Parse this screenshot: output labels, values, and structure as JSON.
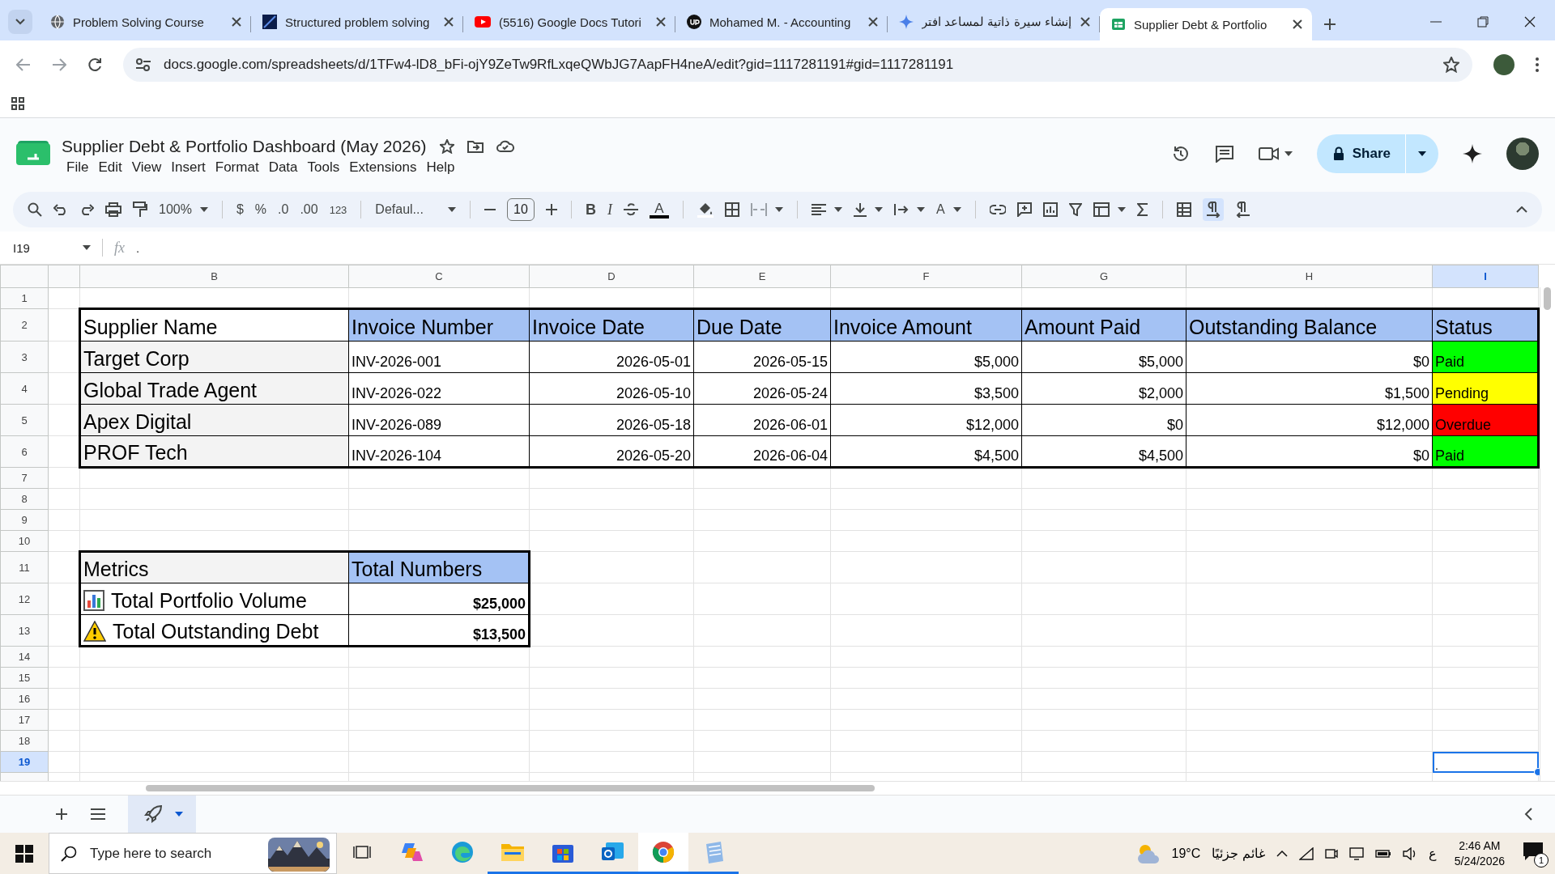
{
  "browser": {
    "tabs": [
      {
        "kind": "globe",
        "title": "Problem Solving Course",
        "selected": false
      },
      {
        "kind": "square",
        "title": "Structured problem solving",
        "selected": false
      },
      {
        "kind": "video",
        "title": "(5516) Google Docs Tutori",
        "selected": false
      },
      {
        "kind": "circle",
        "title": "Mohamed M. - Accounting",
        "selected": false
      },
      {
        "kind": "sparkle",
        "title": "إنشاء سيرة ذاتية لمساعد افتر",
        "selected": false
      },
      {
        "kind": "sheet",
        "title": "Supplier Debt & Portfolio",
        "selected": true
      }
    ],
    "url": "docs.google.com/spreadsheets/d/1TFw4-lD8_bFi-ojY9ZeTw9RfLxqeQWbJG7AapFH4neA/edit?gid=1117281191#gid=1117281191"
  },
  "document": {
    "title": "Supplier Debt & Portfolio Dashboard (May 2026)",
    "menu": [
      "File",
      "Edit",
      "View",
      "Insert",
      "Format",
      "Data",
      "Tools",
      "Extensions",
      "Help"
    ]
  },
  "share_button": {
    "label": "Share"
  },
  "toolbar": {
    "zoom": "100%",
    "currency": "$",
    "percent": "%",
    "decrease_decimals": ".0",
    "increase_decimals": ".00",
    "more_formats": "123",
    "font": "Defaul...",
    "font_size": "10",
    "bold": "B",
    "italic": "I",
    "text_color": "A",
    "text_rotation": "A"
  },
  "formula_bar": {
    "cell_ref": "I19",
    "fx": "fx",
    "content": "."
  },
  "sheet": {
    "columns": [
      {
        "label": "B",
        "selected": false
      },
      {
        "label": "C",
        "selected": false
      },
      {
        "label": "D",
        "selected": false
      },
      {
        "label": "E",
        "selected": false
      },
      {
        "label": "F",
        "selected": false
      },
      {
        "label": "G",
        "selected": false
      },
      {
        "label": "H",
        "selected": false
      },
      {
        "label": "I",
        "selected": true
      }
    ],
    "rows": [
      {
        "label": "1",
        "selected": false
      },
      {
        "label": "2",
        "selected": false
      },
      {
        "label": "3",
        "selected": false
      },
      {
        "label": "4",
        "selected": false
      },
      {
        "label": "5",
        "selected": false
      },
      {
        "label": "6",
        "selected": false
      },
      {
        "label": "7",
        "selected": false
      },
      {
        "label": "8",
        "selected": false
      },
      {
        "label": "9",
        "selected": false
      },
      {
        "label": "10",
        "selected": false
      },
      {
        "label": "11",
        "selected": false
      },
      {
        "label": "12",
        "selected": false
      },
      {
        "label": "13",
        "selected": false
      },
      {
        "label": "14",
        "selected": false
      },
      {
        "label": "15",
        "selected": false
      },
      {
        "label": "16",
        "selected": false
      },
      {
        "label": "17",
        "selected": false
      },
      {
        "label": "18",
        "selected": false
      },
      {
        "label": "19",
        "selected": true
      }
    ],
    "invoice_table": {
      "headers": [
        "Supplier Name",
        "Invoice Number",
        "Invoice Date",
        "Due Date",
        "Invoice Amount",
        "Amount Paid",
        "Outstanding Balance",
        "Status"
      ],
      "rows": [
        {
          "supplier": "Target Corp",
          "invoice": "INV-2026-001",
          "invoice_date": "2026-05-01",
          "due_date": "2026-05-15",
          "amount": "$5,000",
          "paid": "$5,000",
          "outstanding": "$0",
          "status": {
            "label": "Paid",
            "color": "#00ff00"
          }
        },
        {
          "supplier": "Global Trade Agent",
          "invoice": "INV-2026-022",
          "invoice_date": "2026-05-10",
          "due_date": "2026-05-24",
          "amount": "$3,500",
          "paid": "$2,000",
          "outstanding": "$1,500",
          "status": {
            "label": "Pending",
            "color": "#ffff00"
          }
        },
        {
          "supplier": "Apex Digital",
          "invoice": "INV-2026-089",
          "invoice_date": "2026-05-18",
          "due_date": "2026-06-01",
          "amount": "$12,000",
          "paid": "$0",
          "outstanding": "$12,000",
          "status": {
            "label": "Overdue",
            "color": "#ff0000"
          }
        },
        {
          "supplier": "PROF Tech",
          "invoice": "INV-2026-104",
          "invoice_date": "2026-05-20",
          "due_date": "2026-06-04",
          "amount": "$4,500",
          "paid": "$4,500",
          "outstanding": "$0",
          "status": {
            "label": "Paid",
            "color": "#00ff00"
          }
        }
      ]
    },
    "metrics_table": {
      "headers": [
        "Metrics",
        "Total Numbers"
      ],
      "rows": [
        {
          "kind": "chart",
          "label": "Total Portfolio Volume",
          "value": "$25,000"
        },
        {
          "kind": "warning",
          "label": "Total Outstanding Debt",
          "value": "$13,500"
        }
      ]
    },
    "active_cell": {
      "content": "."
    }
  },
  "taskbar": {
    "search": {
      "placeholder": "Type here to search"
    },
    "apps": [
      {
        "kind": "copilot",
        "running": false,
        "selected": false
      },
      {
        "kind": "edge",
        "running": false,
        "selected": false
      },
      {
        "kind": "folder",
        "running": true,
        "selected": false
      },
      {
        "kind": "store",
        "running": true,
        "selected": false
      },
      {
        "kind": "mail",
        "running": true,
        "selected": false
      },
      {
        "kind": "chrome",
        "running": true,
        "selected": true
      },
      {
        "kind": "notes",
        "running": true,
        "selected": false
      }
    ],
    "weather": {
      "temperature": "19°C",
      "condition": "غائم جزئيًا"
    },
    "language": "ع",
    "time": "2:46 AM",
    "date": "5/24/2026",
    "notifications": "1"
  }
}
